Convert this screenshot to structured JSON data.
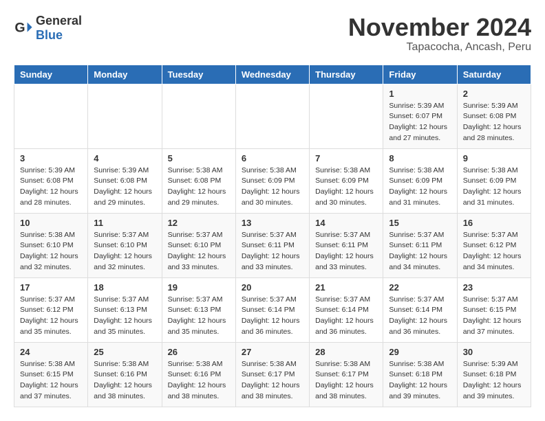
{
  "header": {
    "logo_general": "General",
    "logo_blue": "Blue",
    "month_title": "November 2024",
    "location": "Tapacocha, Ancash, Peru"
  },
  "days_of_week": [
    "Sunday",
    "Monday",
    "Tuesday",
    "Wednesday",
    "Thursday",
    "Friday",
    "Saturday"
  ],
  "weeks": [
    [
      {
        "day": "",
        "info": ""
      },
      {
        "day": "",
        "info": ""
      },
      {
        "day": "",
        "info": ""
      },
      {
        "day": "",
        "info": ""
      },
      {
        "day": "",
        "info": ""
      },
      {
        "day": "1",
        "info": "Sunrise: 5:39 AM\nSunset: 6:07 PM\nDaylight: 12 hours and 27 minutes."
      },
      {
        "day": "2",
        "info": "Sunrise: 5:39 AM\nSunset: 6:08 PM\nDaylight: 12 hours and 28 minutes."
      }
    ],
    [
      {
        "day": "3",
        "info": "Sunrise: 5:39 AM\nSunset: 6:08 PM\nDaylight: 12 hours and 28 minutes."
      },
      {
        "day": "4",
        "info": "Sunrise: 5:39 AM\nSunset: 6:08 PM\nDaylight: 12 hours and 29 minutes."
      },
      {
        "day": "5",
        "info": "Sunrise: 5:38 AM\nSunset: 6:08 PM\nDaylight: 12 hours and 29 minutes."
      },
      {
        "day": "6",
        "info": "Sunrise: 5:38 AM\nSunset: 6:09 PM\nDaylight: 12 hours and 30 minutes."
      },
      {
        "day": "7",
        "info": "Sunrise: 5:38 AM\nSunset: 6:09 PM\nDaylight: 12 hours and 30 minutes."
      },
      {
        "day": "8",
        "info": "Sunrise: 5:38 AM\nSunset: 6:09 PM\nDaylight: 12 hours and 31 minutes."
      },
      {
        "day": "9",
        "info": "Sunrise: 5:38 AM\nSunset: 6:09 PM\nDaylight: 12 hours and 31 minutes."
      }
    ],
    [
      {
        "day": "10",
        "info": "Sunrise: 5:38 AM\nSunset: 6:10 PM\nDaylight: 12 hours and 32 minutes."
      },
      {
        "day": "11",
        "info": "Sunrise: 5:37 AM\nSunset: 6:10 PM\nDaylight: 12 hours and 32 minutes."
      },
      {
        "day": "12",
        "info": "Sunrise: 5:37 AM\nSunset: 6:10 PM\nDaylight: 12 hours and 33 minutes."
      },
      {
        "day": "13",
        "info": "Sunrise: 5:37 AM\nSunset: 6:11 PM\nDaylight: 12 hours and 33 minutes."
      },
      {
        "day": "14",
        "info": "Sunrise: 5:37 AM\nSunset: 6:11 PM\nDaylight: 12 hours and 33 minutes."
      },
      {
        "day": "15",
        "info": "Sunrise: 5:37 AM\nSunset: 6:11 PM\nDaylight: 12 hours and 34 minutes."
      },
      {
        "day": "16",
        "info": "Sunrise: 5:37 AM\nSunset: 6:12 PM\nDaylight: 12 hours and 34 minutes."
      }
    ],
    [
      {
        "day": "17",
        "info": "Sunrise: 5:37 AM\nSunset: 6:12 PM\nDaylight: 12 hours and 35 minutes."
      },
      {
        "day": "18",
        "info": "Sunrise: 5:37 AM\nSunset: 6:13 PM\nDaylight: 12 hours and 35 minutes."
      },
      {
        "day": "19",
        "info": "Sunrise: 5:37 AM\nSunset: 6:13 PM\nDaylight: 12 hours and 35 minutes."
      },
      {
        "day": "20",
        "info": "Sunrise: 5:37 AM\nSunset: 6:14 PM\nDaylight: 12 hours and 36 minutes."
      },
      {
        "day": "21",
        "info": "Sunrise: 5:37 AM\nSunset: 6:14 PM\nDaylight: 12 hours and 36 minutes."
      },
      {
        "day": "22",
        "info": "Sunrise: 5:37 AM\nSunset: 6:14 PM\nDaylight: 12 hours and 36 minutes."
      },
      {
        "day": "23",
        "info": "Sunrise: 5:37 AM\nSunset: 6:15 PM\nDaylight: 12 hours and 37 minutes."
      }
    ],
    [
      {
        "day": "24",
        "info": "Sunrise: 5:38 AM\nSunset: 6:15 PM\nDaylight: 12 hours and 37 minutes."
      },
      {
        "day": "25",
        "info": "Sunrise: 5:38 AM\nSunset: 6:16 PM\nDaylight: 12 hours and 38 minutes."
      },
      {
        "day": "26",
        "info": "Sunrise: 5:38 AM\nSunset: 6:16 PM\nDaylight: 12 hours and 38 minutes."
      },
      {
        "day": "27",
        "info": "Sunrise: 5:38 AM\nSunset: 6:17 PM\nDaylight: 12 hours and 38 minutes."
      },
      {
        "day": "28",
        "info": "Sunrise: 5:38 AM\nSunset: 6:17 PM\nDaylight: 12 hours and 38 minutes."
      },
      {
        "day": "29",
        "info": "Sunrise: 5:38 AM\nSunset: 6:18 PM\nDaylight: 12 hours and 39 minutes."
      },
      {
        "day": "30",
        "info": "Sunrise: 5:39 AM\nSunset: 6:18 PM\nDaylight: 12 hours and 39 minutes."
      }
    ]
  ]
}
